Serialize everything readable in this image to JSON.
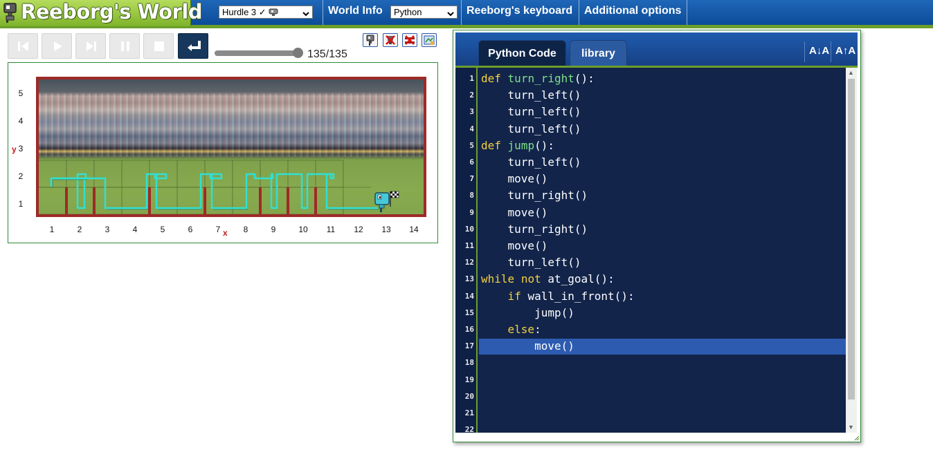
{
  "header": {
    "logo_text": "Reeborg's World",
    "world_select": "Hurdle 3 ✓",
    "world_info": "World Info",
    "language_select": "Python",
    "keyboard": "Reeborg's keyboard",
    "options": "Additional options"
  },
  "controls": {
    "step_counter": "135/135",
    "step_current": 135,
    "step_total": 135
  },
  "world": {
    "y_label": "y",
    "x_label": "x",
    "y_ticks": [
      "1",
      "2",
      "3",
      "4",
      "5"
    ],
    "x_ticks": [
      "1",
      "2",
      "3",
      "4",
      "5",
      "6",
      "7",
      "8",
      "9",
      "10",
      "11",
      "12",
      "13",
      "14"
    ]
  },
  "editor": {
    "tabs": [
      "Python Code",
      "library"
    ],
    "font_decrease": "A↓A",
    "font_increase": "A↑A",
    "active_line": 17,
    "line_numbers": [
      "1",
      "2",
      "3",
      "4",
      "5",
      "6",
      "7",
      "8",
      "9",
      "10",
      "11",
      "12",
      "13",
      "14",
      "15",
      "16",
      "17",
      "18",
      "19",
      "20",
      "21",
      "22"
    ],
    "code_lines": [
      "def turn_right():",
      "    turn_left()",
      "    turn_left()",
      "    turn_left()",
      "def jump():",
      "    turn_left()",
      "    move()",
      "    turn_right()",
      "    move()",
      "    turn_right()",
      "    move()",
      "    turn_left()",
      "while not at_goal():",
      "    if wall_in_front():",
      "        jump()",
      "    else:",
      "        move()",
      "",
      "",
      "",
      "",
      ""
    ]
  },
  "colors": {
    "header_blue": "#0c4c98",
    "accent_green": "#6c9e2a",
    "editor_bg": "#12244a",
    "keyword": "#f5d140",
    "function_name": "#7fe08a",
    "wall": "#9e2a27",
    "trace": "#2fe0d4"
  },
  "icons": [
    "robot-logo-icon",
    "first-step-icon",
    "play-icon",
    "step-forward-icon",
    "pause-icon",
    "stop-icon",
    "reload-icon",
    "robot-model-icon",
    "delete-robot-icon",
    "delete-walls-icon",
    "world-editor-icon"
  ]
}
